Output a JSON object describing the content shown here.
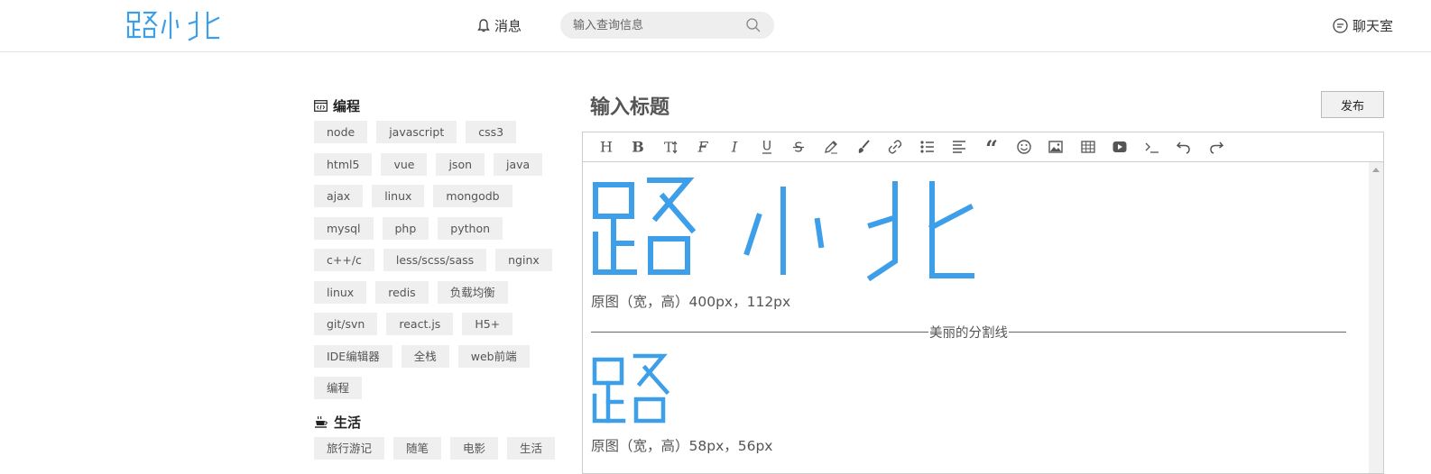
{
  "header": {
    "logo_text": "路小北",
    "messages_label": "消息",
    "search_placeholder": "输入查询信息",
    "chat_label": "聊天室"
  },
  "sidebar": {
    "categories": [
      {
        "title": "编程",
        "icon": "code-icon",
        "tags": [
          "node",
          "javascript",
          "css3",
          "html5",
          "vue",
          "json",
          "java",
          "ajax",
          "linux",
          "mongodb",
          "mysql",
          "php",
          "python",
          "c++/c",
          "less/scss/sass",
          "nginx",
          "linux",
          "redis",
          "负载均衡",
          "git/svn",
          "react.js",
          "H5+",
          "IDE编辑器",
          "全栈",
          "web前端",
          "编程"
        ]
      },
      {
        "title": "生活",
        "icon": "coffee-cup-icon",
        "tags": [
          "旅行游记",
          "随笔",
          "电影",
          "生活"
        ]
      }
    ]
  },
  "editor": {
    "title_placeholder": "输入标题",
    "publish_label": "发布",
    "toolbar": [
      "heading-icon",
      "bold-icon",
      "text-size-icon",
      "font-icon",
      "italic-icon",
      "underline-icon",
      "strikethrough-icon",
      "pen-icon",
      "brush-icon",
      "link-icon",
      "bullet-list-icon",
      "align-left-icon",
      "quote-icon",
      "emoji-icon",
      "image-icon",
      "table-icon",
      "video-icon",
      "code-icon",
      "undo-icon",
      "redo-icon"
    ],
    "content": {
      "image1_alt": "路小北",
      "caption1": "原图（宽，高）400px，112px",
      "divider_text": "美丽的分割线",
      "image2_alt": "路",
      "caption2": "原图（宽，高）58px，56px"
    }
  },
  "colors": {
    "brand": "#3d9ee9",
    "tag_bg": "#efefef",
    "search_bg": "#eeeeee"
  }
}
